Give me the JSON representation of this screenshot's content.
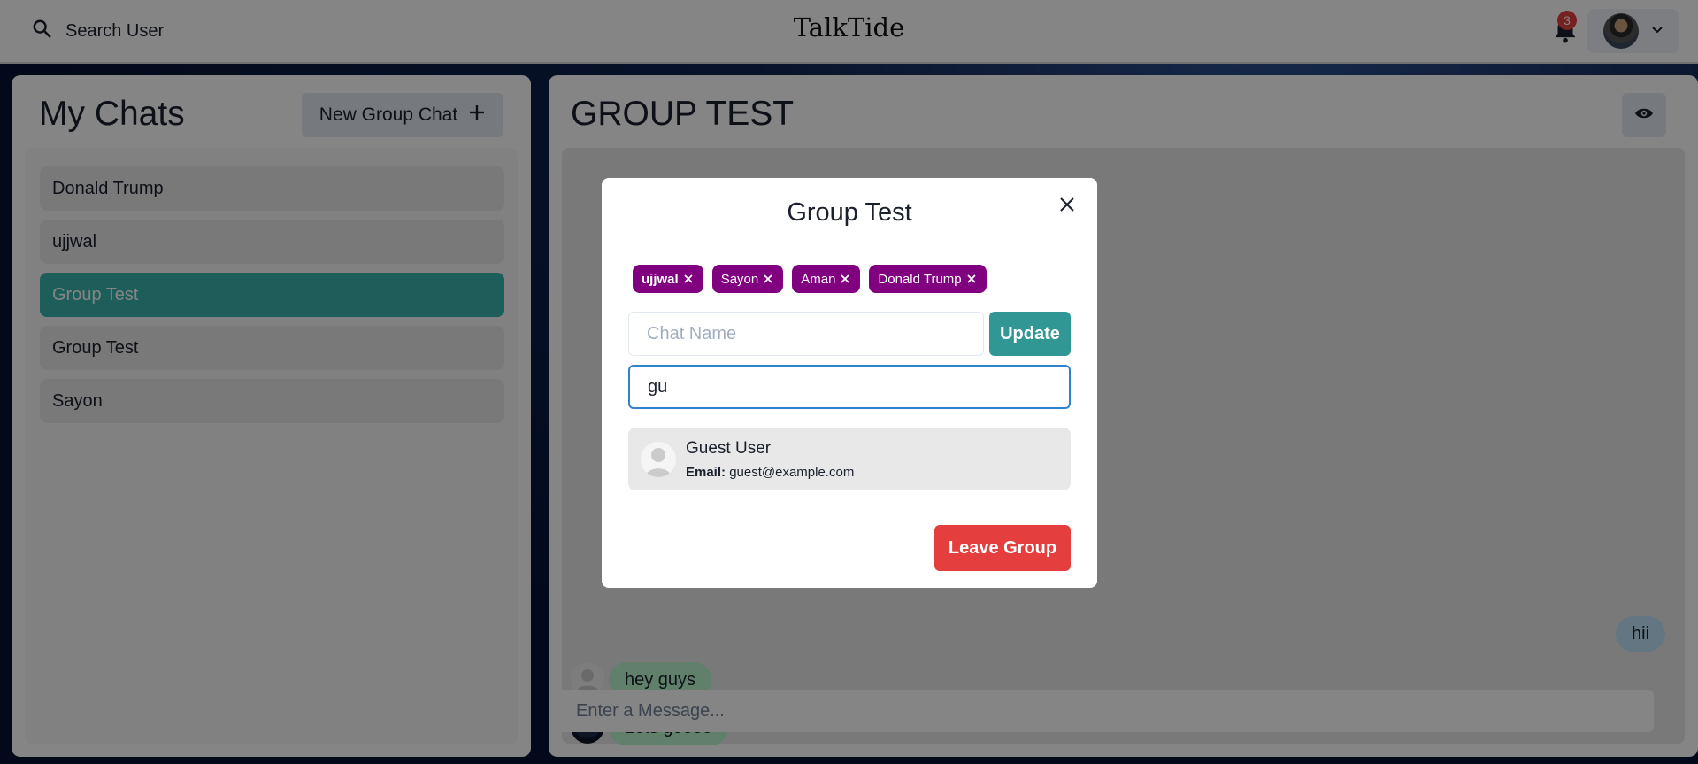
{
  "topbar": {
    "search_label": "Search User",
    "brand": "TalkTide",
    "notification_count": "3",
    "search_icon": "search-icon",
    "bell_icon": "bell-icon",
    "chevron_icon": "chevron-down-icon"
  },
  "sidebar": {
    "title": "My Chats",
    "new_group_label": "New Group Chat",
    "new_group_icon": "plus-icon",
    "chats": [
      {
        "label": "Donald Trump",
        "active": false
      },
      {
        "label": "ujjwal",
        "active": false
      },
      {
        "label": "Group Test",
        "active": true
      },
      {
        "label": "Group Test",
        "active": false
      },
      {
        "label": "Sayon",
        "active": false
      }
    ]
  },
  "main": {
    "chat_title": "GROUP TEST",
    "eye_icon": "eye-icon",
    "messages": [
      {
        "text": "hii",
        "mine": true
      },
      {
        "text": "hey guys",
        "mine": false
      },
      {
        "text": "Lets goooo",
        "mine": false
      }
    ],
    "input_placeholder": "Enter a Message..."
  },
  "modal": {
    "title": "Group Test",
    "members": [
      "ujjwal",
      "Sayon",
      "Aman",
      "Donald Trump"
    ],
    "chat_name_placeholder": "Chat Name",
    "update_label": "Update",
    "search_value": "gu",
    "result": {
      "name": "Guest User",
      "email_label": "Email:",
      "email": "guest@example.com"
    },
    "leave_label": "Leave Group"
  },
  "colors": {
    "accent": "#38b2ac",
    "tag": "#800080",
    "danger": "#e53e3e",
    "update": "#319795",
    "focus": "#3182ce"
  }
}
